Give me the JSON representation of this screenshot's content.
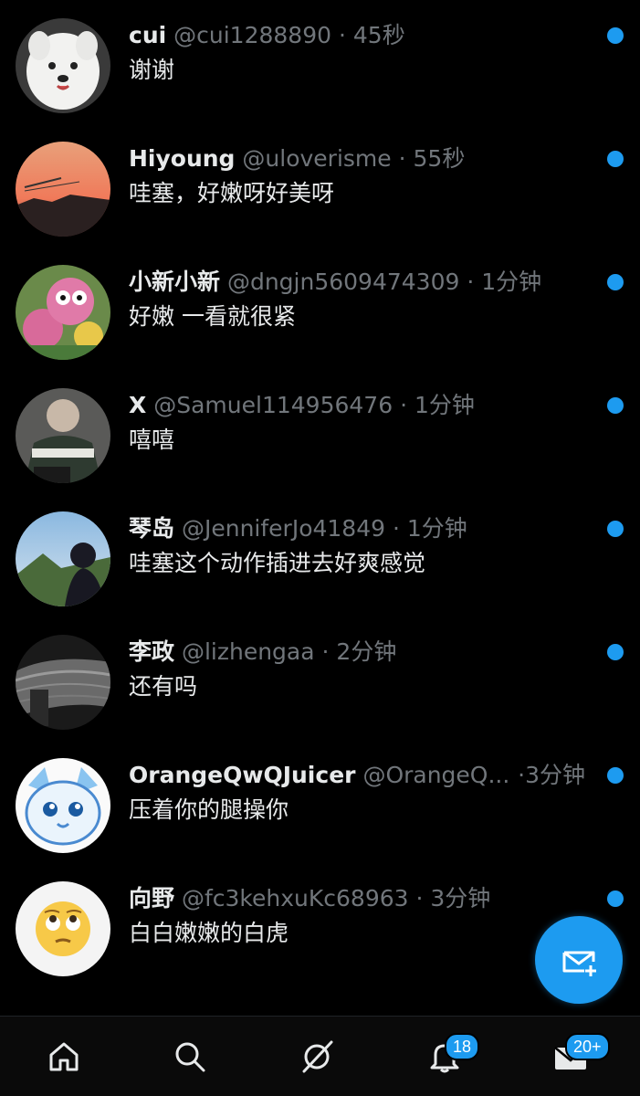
{
  "messages": [
    {
      "name": "cui",
      "handle": "@cui1288890",
      "time": "45秒",
      "text": "谢谢"
    },
    {
      "name": "Hiyoung",
      "handle": "@uloverisme",
      "time": "55秒",
      "text": "哇塞，好嫩呀好美呀"
    },
    {
      "name": "小新小新",
      "handle": "@dngjn5609474309",
      "time": "1分钟",
      "text": "好嫩 一看就很紧"
    },
    {
      "name": "X",
      "handle": "@Samuel114956476",
      "time": "1分钟",
      "text": "嘻嘻"
    },
    {
      "name": "琴岛",
      "handle": "@JenniferJo41849",
      "time": "1分钟",
      "text": "哇塞这个动作插进去好爽感觉"
    },
    {
      "name": "李政",
      "handle": "@lizhengaa",
      "time": "2分钟",
      "text": "还有吗"
    },
    {
      "name": "OrangeQwQJuicer",
      "handle": "@OrangeQ...",
      "time": "3分钟",
      "text": "压着你的腿操你"
    },
    {
      "name": "向野",
      "handle": "@fc3kehxuKc68963",
      "time": "3分钟",
      "text": "白白嫩嫩的白虎"
    }
  ],
  "separator": "·",
  "nav": {
    "icons": [
      "home-icon",
      "search-icon",
      "grok-icon",
      "notifications-icon",
      "messages-icon"
    ],
    "notifications_badge": "18",
    "messages_badge": "20+"
  },
  "colors": {
    "accent": "#1d9bf0",
    "background": "#000000",
    "muted": "#71767b"
  }
}
